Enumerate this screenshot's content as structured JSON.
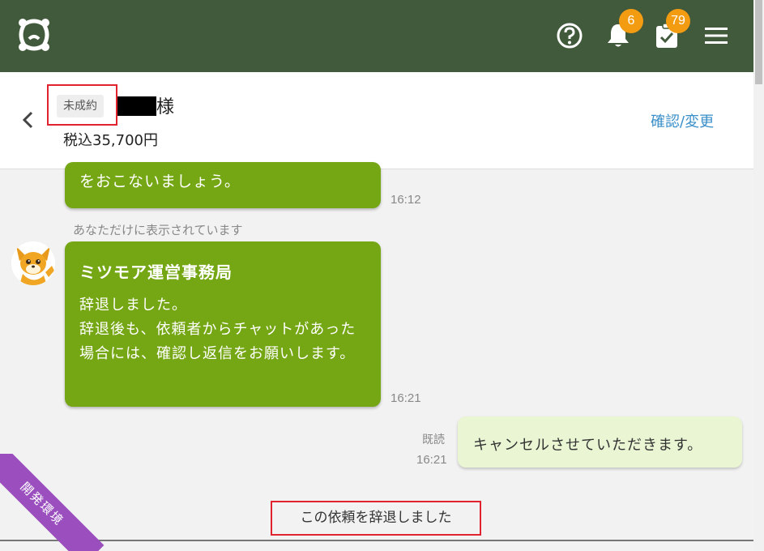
{
  "topbar": {
    "logo_icon": "app-logo-icon",
    "help_icon": "help-circle-icon",
    "bell_icon": "bell-icon",
    "task_icon": "task-check-icon",
    "menu_icon": "hamburger-menu-icon",
    "notification_count": "6",
    "task_count": "79",
    "badge_color": "#f39c12",
    "background_color": "#415a3c"
  },
  "header": {
    "status_tag": "未成約",
    "client_suffix": "様",
    "price": "税込35,700円",
    "confirm_link": "確認/変更"
  },
  "chat": {
    "messages": [
      {
        "text": "をおこないましょう。",
        "time": "16:12"
      },
      {
        "notice": "あなただけに表示されています",
        "sender": "ミツモア運営事務局",
        "body": "辞退しました。\n辞退後も、依頼者からチャットがあった場合には、確認し返信をお願いします。",
        "time": "16:21"
      },
      {
        "text": "キャンセルさせていただきます。",
        "read": "既読",
        "time": "16:21"
      }
    ],
    "system_message": "この依頼を辞退しました",
    "bubble_color": "#74a713"
  },
  "ribbon": {
    "label": "開発環境"
  }
}
